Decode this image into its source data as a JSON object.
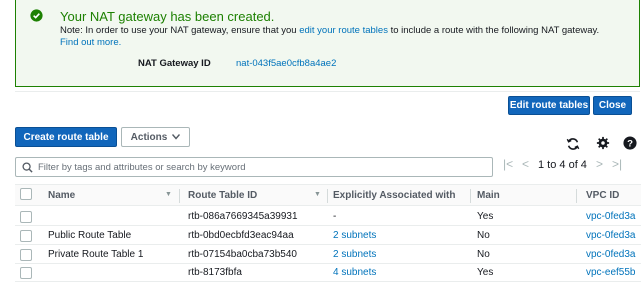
{
  "banner": {
    "title": "Your NAT gateway has been created.",
    "note_prefix": "Note: In order to use your NAT gateway, ensure that you",
    "note_link": "edit your route tables",
    "note_suffix": "to include a route with the following NAT gateway.",
    "learn_more": "Find out more.",
    "nat_label": "NAT Gateway ID",
    "nat_id": "nat-043f5ae0cfb8a4ae2",
    "success_color": "#1d8102"
  },
  "actions": {
    "edit_route_tables": "Edit route tables",
    "close": "Close",
    "create_route_table": "Create route table",
    "actions_menu": "Actions"
  },
  "toolbar_icons": [
    "refresh-icon",
    "gear-icon",
    "help-icon"
  ],
  "filter": {
    "placeholder": "Filter by tags and attributes or search by keyword",
    "value": ""
  },
  "pagination": {
    "range": "1 to 4 of 4"
  },
  "table": {
    "columns": [
      "Name",
      "Route Table ID",
      "Explicitly Associated with",
      "Main",
      "VPC ID"
    ],
    "rows": [
      {
        "name": "",
        "id": "rtb-086a7669345a39931",
        "assoc": "-",
        "main": "Yes",
        "vpc": "vpc-0fed3a"
      },
      {
        "name": "Public Route Table",
        "id": "rtb-0bd0ecbfd3eac94aa",
        "assoc": "2 subnets",
        "main": "No",
        "vpc": "vpc-0fed3a"
      },
      {
        "name": "Private Route Table 1",
        "id": "rtb-07154ba0cba73b540",
        "assoc": "2 subnets",
        "main": "No",
        "vpc": "vpc-0fed3a"
      },
      {
        "name": "",
        "id": "rtb-8173fbfa",
        "assoc": "4 subnets",
        "main": "Yes",
        "vpc": "vpc-eef55b"
      }
    ]
  }
}
